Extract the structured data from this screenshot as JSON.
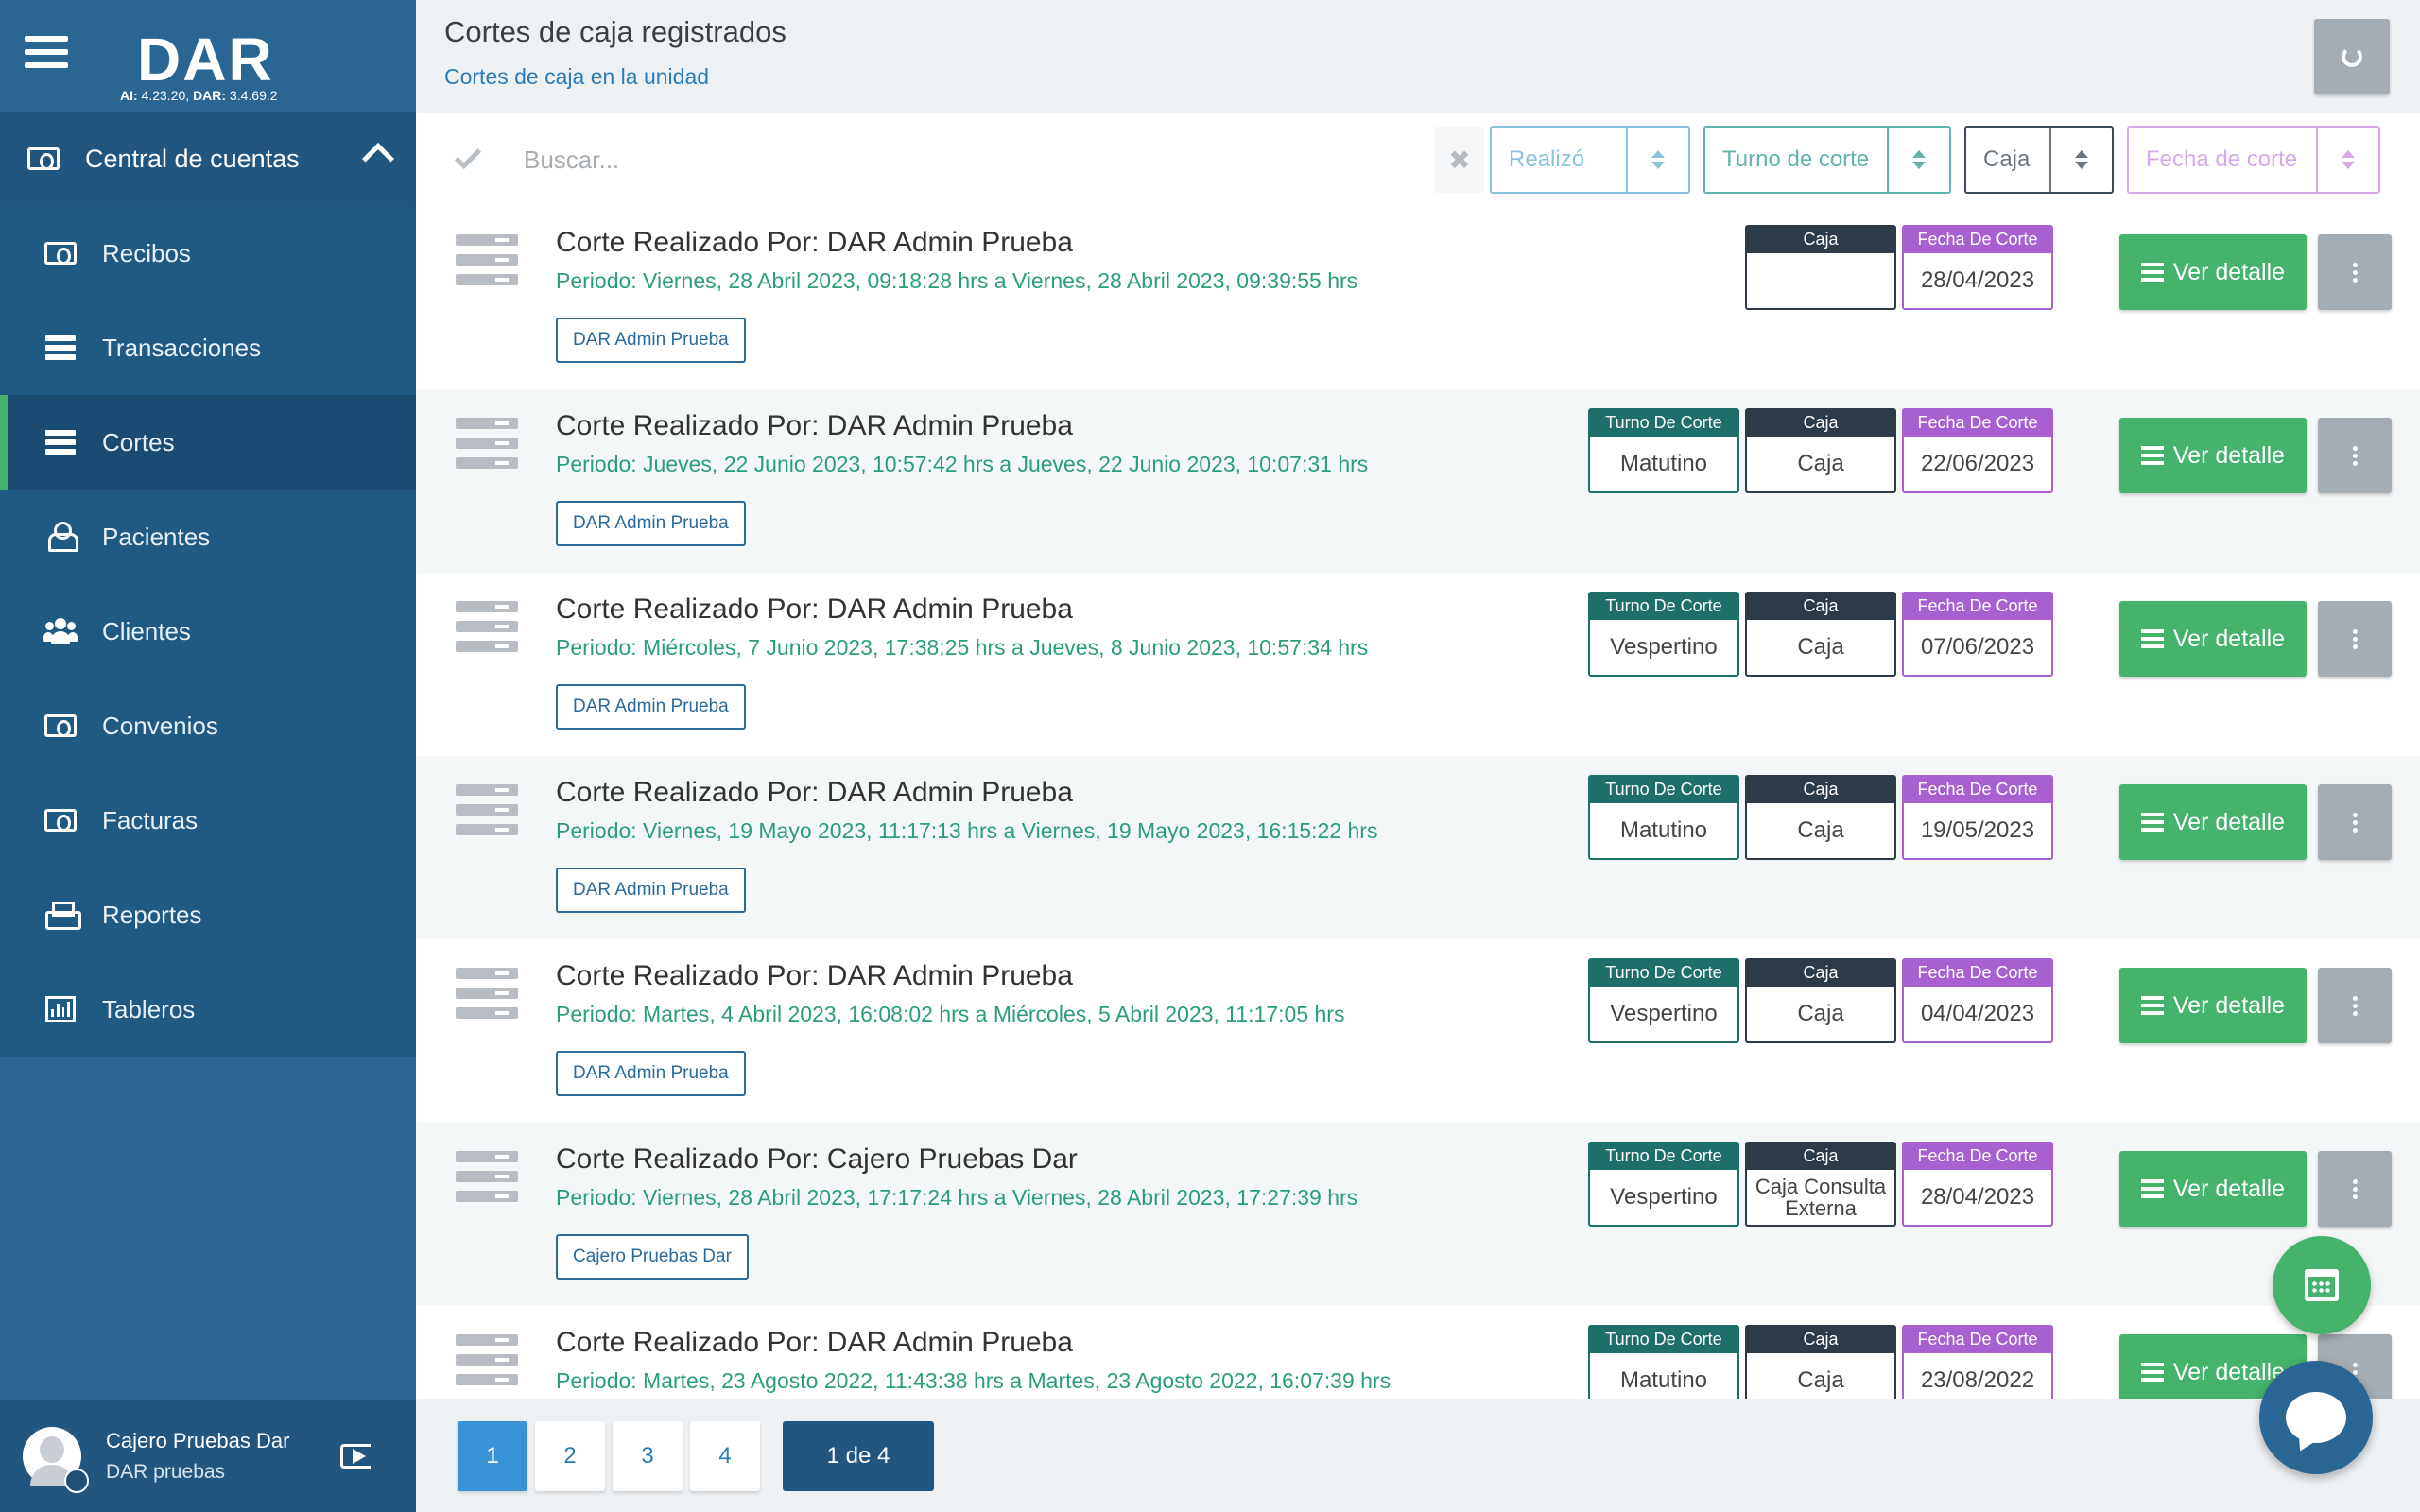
{
  "app": {
    "brand": "DAR",
    "version_ai_label": "AI:",
    "version_ai": "4.23.20,",
    "version_dar_label": "DAR:",
    "version_dar": "3.4.69.2"
  },
  "sidebar": {
    "section_label": "Central de cuentas",
    "items": [
      {
        "label": "Recibos",
        "icon": "money-icon"
      },
      {
        "label": "Transacciones",
        "icon": "server-icon"
      },
      {
        "label": "Cortes",
        "icon": "server-icon",
        "active": true
      },
      {
        "label": "Pacientes",
        "icon": "user-icon"
      },
      {
        "label": "Clientes",
        "icon": "users-icon"
      },
      {
        "label": "Convenios",
        "icon": "money-icon"
      },
      {
        "label": "Facturas",
        "icon": "money-icon"
      },
      {
        "label": "Reportes",
        "icon": "print-icon"
      },
      {
        "label": "Tableros",
        "icon": "bar-chart-icon"
      }
    ],
    "user": {
      "name": "Cajero Pruebas Dar",
      "org": "DAR pruebas"
    }
  },
  "header": {
    "title": "Cortes de caja registrados",
    "subtitle": "Cortes de caja en la unidad"
  },
  "filters": {
    "search_placeholder": "Buscar...",
    "clear_label": "✖",
    "realizo": "Realizó",
    "turno": "Turno de corte",
    "caja": "Caja",
    "fecha": "Fecha de corte"
  },
  "labels": {
    "turno_head": "Turno De Corte",
    "caja_head": "Caja",
    "fecha_head": "Fecha De Corte",
    "detail_button": "Ver detalle"
  },
  "rows": [
    {
      "title": "Corte Realizado Por: DAR Admin Prueba",
      "period": "Periodo: Viernes, 28 Abril 2023, 09:18:28 hrs a Viernes, 28 Abril 2023, 09:39:55 hrs",
      "tag": "DAR Admin Prueba",
      "turno": null,
      "caja": "",
      "fecha": "28/04/2023"
    },
    {
      "title": "Corte Realizado Por: DAR Admin Prueba",
      "period": "Periodo: Jueves, 22 Junio 2023, 10:57:42 hrs a Jueves, 22 Junio 2023, 10:07:31 hrs",
      "tag": "DAR Admin Prueba",
      "turno": "Matutino",
      "caja": "Caja",
      "fecha": "22/06/2023"
    },
    {
      "title": "Corte Realizado Por: DAR Admin Prueba",
      "period": "Periodo: Miércoles, 7 Junio 2023, 17:38:25 hrs a Jueves, 8 Junio 2023, 10:57:34 hrs",
      "tag": "DAR Admin Prueba",
      "turno": "Vespertino",
      "caja": "Caja",
      "fecha": "07/06/2023"
    },
    {
      "title": "Corte Realizado Por: DAR Admin Prueba",
      "period": "Periodo: Viernes, 19 Mayo 2023, 11:17:13 hrs a Viernes, 19 Mayo 2023, 16:15:22 hrs",
      "tag": "DAR Admin Prueba",
      "turno": "Matutino",
      "caja": "Caja",
      "fecha": "19/05/2023"
    },
    {
      "title": "Corte Realizado Por: DAR Admin Prueba",
      "period": "Periodo: Martes, 4 Abril 2023, 16:08:02 hrs a Miércoles, 5 Abril 2023, 11:17:05 hrs",
      "tag": "DAR Admin Prueba",
      "turno": "Vespertino",
      "caja": "Caja",
      "fecha": "04/04/2023"
    },
    {
      "title": "Corte Realizado Por: Cajero Pruebas Dar",
      "period": "Periodo: Viernes, 28 Abril 2023, 17:17:24 hrs a Viernes, 28 Abril 2023, 17:27:39 hrs",
      "tag": "Cajero Pruebas Dar",
      "turno": "Vespertino",
      "caja": "Caja Consulta Externa",
      "fecha": "28/04/2023"
    },
    {
      "title": "Corte Realizado Por: DAR Admin Prueba",
      "period": "Periodo: Martes, 23 Agosto 2022, 11:43:38 hrs a Martes, 23 Agosto 2022, 16:07:39 hrs",
      "tag": "DAR Admin Prueba",
      "turno": "Matutino",
      "caja": "Caja",
      "fecha": "23/08/2022"
    }
  ],
  "pagination": {
    "pages": [
      "1",
      "2",
      "3",
      "4"
    ],
    "current": "1",
    "info": "1 de 4"
  },
  "colors": {
    "sidebar": "#2a6694",
    "accent_green": "#45b36b",
    "turno": "#1e6f6a",
    "caja": "#2d3a48",
    "fecha": "#a85fcf"
  }
}
